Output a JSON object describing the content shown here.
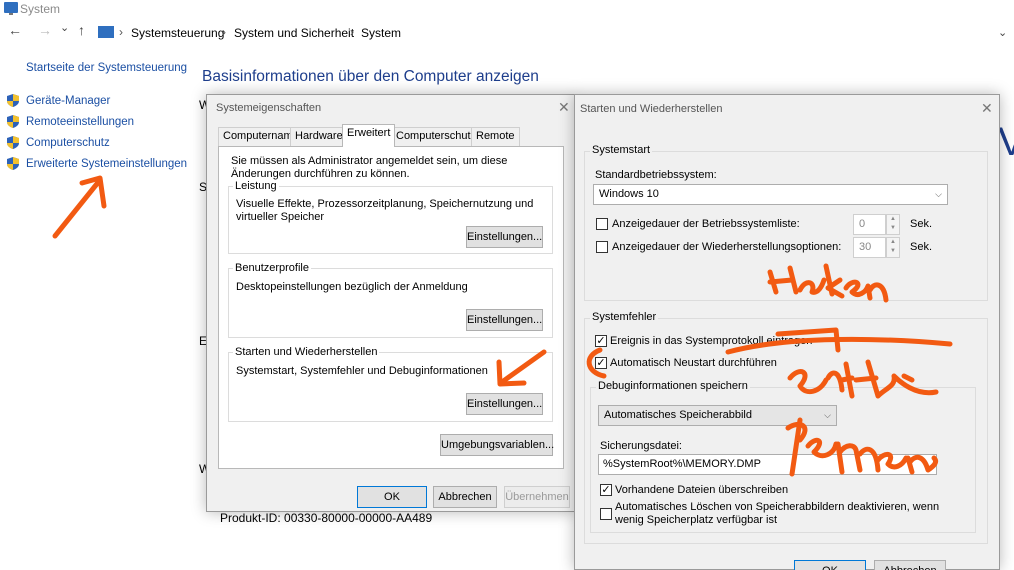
{
  "window": {
    "title": "System",
    "nav": {
      "back": "←",
      "forward": "→",
      "recent": "⌄",
      "up": "↑"
    },
    "breadcrumb": [
      "Systemsteuerung",
      "System und Sicherheit",
      "System"
    ],
    "breadcrumb_sep": "›",
    "address_dropdown": "⌄"
  },
  "sidebar": {
    "home": "Startseite der Systemsteuerung",
    "items": [
      {
        "label": "Geräte-Manager",
        "icon": "shield-icon"
      },
      {
        "label": "Remoteeinstellungen",
        "icon": "shield-icon"
      },
      {
        "label": "Computerschutz",
        "icon": "shield-icon"
      },
      {
        "label": "Erweiterte Systemeinstellungen",
        "icon": "shield-icon"
      }
    ]
  },
  "main": {
    "heading": "Basisinformationen über den Computer anzeigen",
    "peek_letters": [
      "W",
      "S",
      "Ei",
      "W"
    ],
    "product_id": "Produkt-ID: 00330-80000-00000-AA489",
    "partial_heading": "V"
  },
  "sysprops": {
    "title": "Systemeigenschaften",
    "close": "✕",
    "tabs": [
      "Computername",
      "Hardware",
      "Erweitert",
      "Computerschutz",
      "Remote"
    ],
    "active_tab": "Erweitert",
    "admin_note": "Sie müssen als Administrator angemeldet sein, um diese Änderungen durchführen zu können.",
    "groups": [
      {
        "label": "Leistung",
        "text": "Visuelle Effekte, Prozessorzeitplanung, Speichernutzung und virtueller Speicher",
        "button": "Einstellungen..."
      },
      {
        "label": "Benutzerprofile",
        "text": "Desktopeinstellungen bezüglich der Anmeldung",
        "button": "Einstellungen..."
      },
      {
        "label": "Starten und Wiederherstellen",
        "text": "Systemstart, Systemfehler und Debuginformationen",
        "button": "Einstellungen..."
      }
    ],
    "env_button": "Umgebungsvariablen...",
    "ok": "OK",
    "cancel": "Abbrechen",
    "apply": "Übernehmen"
  },
  "startup": {
    "title": "Starten und Wiederherstellen",
    "close": "✕",
    "systemstart": {
      "label": "Systemstart",
      "default_os_label": "Standardbetriebssystem:",
      "default_os_value": "Windows 10",
      "list_time_label": "Anzeigedauer der Betriebssystemliste:",
      "list_time_checked": false,
      "list_time_value": "0",
      "recovery_time_label": "Anzeigedauer der Wiederherstellungsoptionen:",
      "recovery_time_checked": false,
      "recovery_time_value": "30",
      "unit": "Sek."
    },
    "systemfehler": {
      "label": "Systemfehler",
      "log_event_label": "Ereignis in das Systemprotokoll eintragen",
      "log_event_checked": true,
      "auto_restart_label": "Automatisch Neustart durchführen",
      "auto_restart_checked": true,
      "debug_label": "Debuginformationen speichern",
      "debug_value": "Automatisches Speicherabbild",
      "dump_file_label": "Sicherungsdatei:",
      "dump_file_value": "%SystemRoot%\\MEMORY.DMP",
      "overwrite_label": "Vorhandene Dateien überschreiben",
      "overwrite_checked": true,
      "disable_delete_label": "Automatisches Löschen von Speicherabbildern deaktivieren, wenn wenig Speicherplatz verfügbar ist",
      "disable_delete_checked": false
    },
    "ok": "OK",
    "cancel": "Abbrechen"
  },
  "annotations": {
    "handwriting": [
      "Haken",
      "entfernen"
    ],
    "color": "#f25a12"
  },
  "colors": {
    "link": "#1b4fa3",
    "heading": "#1e3e8c",
    "dialog_bg": "#f0f0f0",
    "focus_border": "#0078d7",
    "annotation": "#f25a12"
  }
}
